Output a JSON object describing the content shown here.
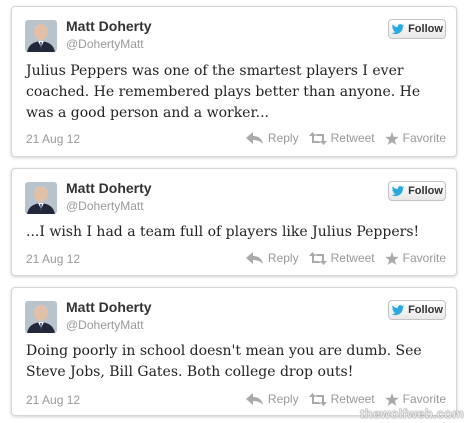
{
  "tweets": [
    {
      "name": "Matt Doherty",
      "handle": "@DohertyMatt",
      "follow_label": "Follow",
      "text": "Julius Peppers was one of the smartest players I ever coached. He remembered plays better than anyone. He was a good person and a worker...",
      "date": "21 Aug 12",
      "reply_label": "Reply",
      "retweet_label": "Retweet",
      "favorite_label": "Favorite"
    },
    {
      "name": "Matt Doherty",
      "handle": "@DohertyMatt",
      "follow_label": "Follow",
      "text": "...I wish I had a team full of players like Julius Peppers!",
      "date": "21 Aug 12",
      "reply_label": "Reply",
      "retweet_label": "Retweet",
      "favorite_label": "Favorite"
    },
    {
      "name": "Matt Doherty",
      "handle": "@DohertyMatt",
      "follow_label": "Follow",
      "text": "Doing poorly in school doesn't mean you are dumb. See Steve Jobs, Bill Gates. Both college drop outs!",
      "date": "21 Aug 12",
      "reply_label": "Reply",
      "retweet_label": "Retweet",
      "favorite_label": "Favorite"
    }
  ],
  "watermark": "thewolfweb.com",
  "colors": {
    "twitter_bird": "#2aa9e0",
    "meta_gray": "#999999",
    "name_text": "#333333"
  }
}
